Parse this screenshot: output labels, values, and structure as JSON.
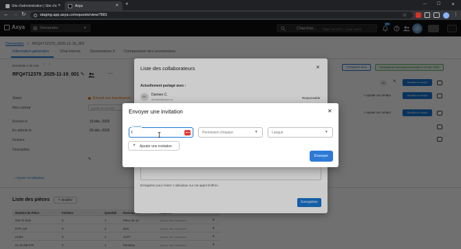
{
  "browser": {
    "tabs": [
      {
        "title": "Site d'administration | Site d'a"
      },
      {
        "title": "Axya"
      }
    ],
    "url": "staging.app.axya.co/requests/view/7881"
  },
  "icons": {
    "close": "✕",
    "minimize": "—",
    "maximize": "☐",
    "new_tab": "+",
    "back": "←",
    "forward": "→",
    "reload": "↻",
    "star": "☆",
    "menu": "⋮",
    "chevron_down": "▾",
    "chevron_left": "‹",
    "chevron_right": "›",
    "edit": "✎",
    "plus": "+",
    "more": "⋯",
    "grid": "▦"
  },
  "nav": {
    "logo": "Axya",
    "module": "Demandes",
    "search_placeholder": "Chercher...",
    "search_hint": "Taper sur Ctrl + / pour ouvrir",
    "notif_count": "99+"
  },
  "page": {
    "breadcrumb": {
      "root": "Demandes",
      "sep": ">",
      "current": "RFQ#712379_2025-11-19_001"
    },
    "tabs": [
      "Information générales",
      "Chat interne",
      "Soumissions 0",
      "Comparaison des soumissions"
    ],
    "pager": "Demande 1 de 136",
    "title": "RFQ#712379_2025-11-19_001",
    "actions": {
      "compare": "Comparer tous",
      "status_pill": "Demande de soumissions terminée le 19 déc. 2025"
    },
    "right_panel": {
      "lang": "EN",
      "add_contact": "Ajouter un contact",
      "edit_status": "Modifier le statut"
    },
    "fields": [
      {
        "label": "Statut",
        "value": "Envoyé aux fournisseurs"
      },
      {
        "label": "Mon contrat",
        "value": "Ajouter un contrat"
      },
      {
        "label": "Envoyé le",
        "value": "19-déc.-2025"
      },
      {
        "label": "En attente le",
        "value": "02-déc.-2025"
      },
      {
        "label": "Fichiers"
      },
      {
        "label": "Description"
      }
    ],
    "add_user": "Ajouter un utilisateur",
    "parts": {
      "title": "Liste des pièces",
      "edit": "Modifier",
      "headers": [
        "Numéro de Pièce",
        "Fichiers",
        "Quantité",
        "Description",
        "Étiquette"
      ],
      "rows": [
        {
          "number": "000-72-bois",
          "files": "0",
          "qty": "1",
          "description": "Pièce de 10",
          "tags": "Ajouter des étiquettes"
        },
        {
          "number": "DTR 143",
          "files": "0",
          "qty": "2",
          "description": "Bois",
          "tags": "Ajouter des étiquettes"
        },
        {
          "number": "21321",
          "files": "0",
          "qty": "1",
          "description": "ALST",
          "tags": "Ajouter des étiquettes"
        },
        {
          "number": "21-31-DB-375",
          "files": "0",
          "qty": "1",
          "description": "Panneau",
          "tags": "Ajouter des étiquettes"
        }
      ]
    }
  },
  "collab_modal": {
    "title": "Liste des collaborateurs",
    "shared_with": "Actuellement partagé avec :",
    "members": [
      {
        "initials": "DC",
        "name": "Damien C.",
        "email": "damien@axya.co",
        "role": "Responsable"
      }
    ],
    "save_hint": "Enregistrer pour inviter 1 utilisateur sur cet appel d'offres",
    "save": "Enregistrer"
  },
  "invite_modal": {
    "title": "Envoyer une invitation",
    "email_label": "Courriel",
    "email_value": "t",
    "permission_placeholder": "Permission d'équipe",
    "language_placeholder": "Langue",
    "add_invitation": "Ajouter une invitation",
    "send": "Envoyer"
  },
  "colors": {
    "accent": "#1976d2",
    "send_button": "#2d7ad6",
    "status_green": "#2e7d32",
    "status_orange": "#ef6c00",
    "error_red": "#e53935",
    "navbar": "#101010"
  }
}
